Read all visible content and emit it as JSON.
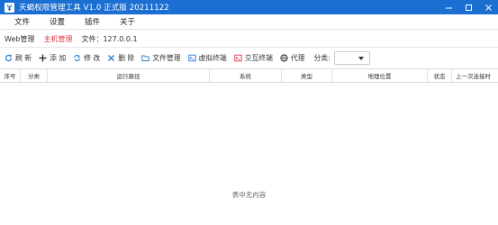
{
  "window": {
    "title": "天蝎权限管理工具 V1.0 正式版 20211122",
    "app_icon": "scorpion-icon",
    "controls": [
      "minimize-icon",
      "maximize-icon",
      "close-icon"
    ]
  },
  "menu": {
    "items": [
      "文件",
      "设置",
      "插件",
      "关于"
    ]
  },
  "tabs": {
    "items": [
      "Web管理",
      "主机管理",
      "文件：127.0.0.1"
    ],
    "active": "主机管理"
  },
  "toolbar": {
    "refresh": "刷 新",
    "add": "添 加",
    "edit": "修 改",
    "delete": "删 除",
    "file_manager": "文件管理",
    "virtual_terminal": "虚拟终端",
    "interactive_terminal": "交互终端",
    "proxy": "代理",
    "category_label": "分类:",
    "category_value": ""
  },
  "table": {
    "columns": [
      "序号",
      "分类",
      "运行路径",
      "系统",
      "类型",
      "地理位置",
      "状态",
      "上一次连接时"
    ],
    "rows": [],
    "empty_text": "表中无内容"
  },
  "colors": {
    "titlebar": "#1c6fd2",
    "active_tab": "#e0393e",
    "icon_blue": "#2a7ad5",
    "icon_red": "#e0393e"
  }
}
